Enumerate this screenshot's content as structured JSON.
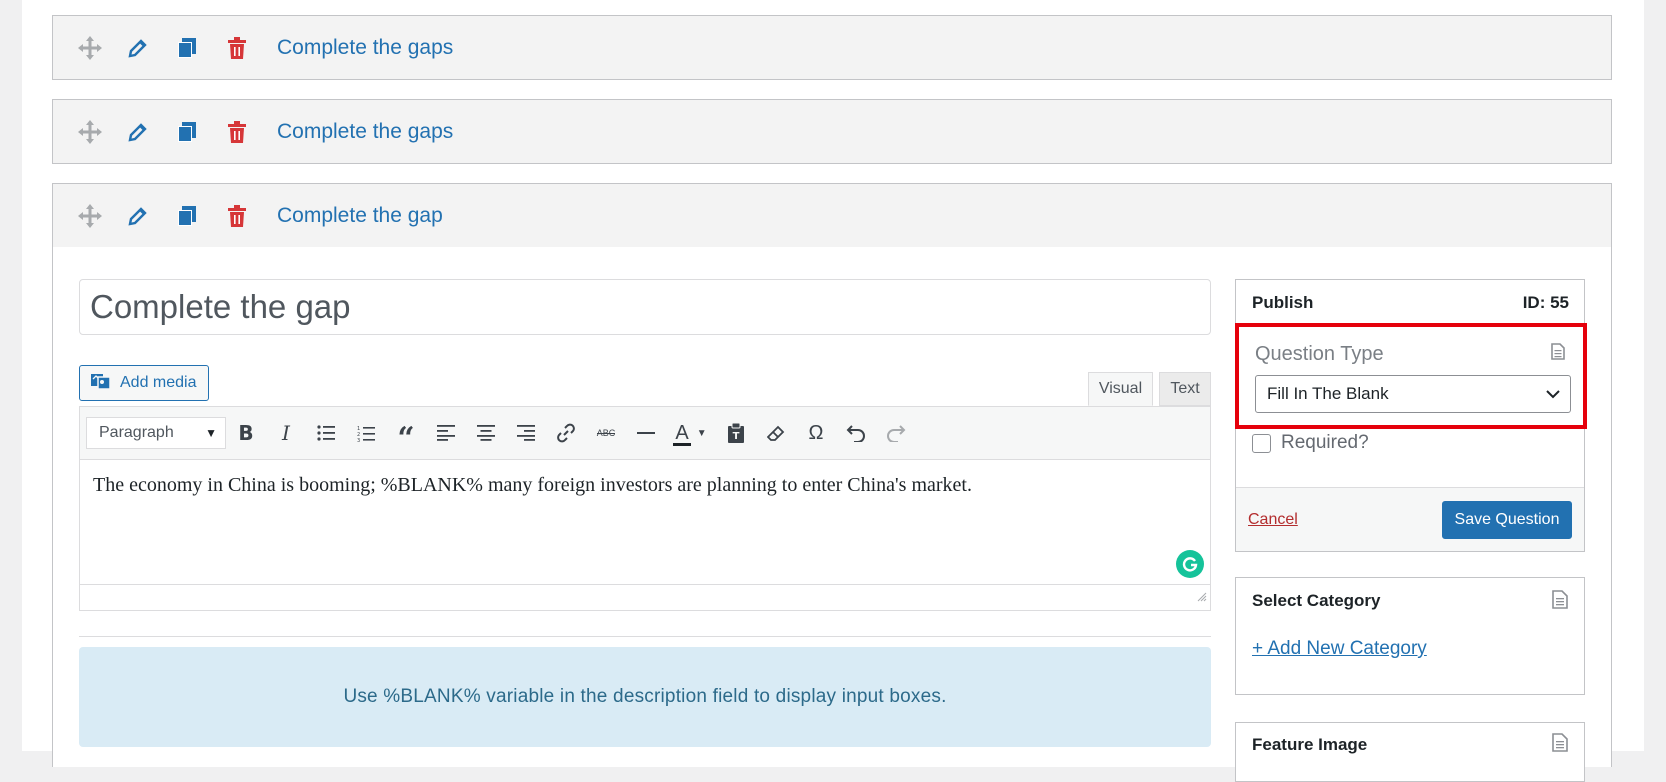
{
  "questions": [
    {
      "title": "Complete the gaps"
    },
    {
      "title": "Complete the gaps"
    },
    {
      "title": "Complete the gap"
    }
  ],
  "row_icons": {
    "move": "move-arrows-icon",
    "edit": "pencil-icon",
    "duplicate": "duplicate-icon",
    "delete": "trash-icon"
  },
  "editor": {
    "title_value": "Complete the gap",
    "add_media_label": "Add media",
    "tab_visual": "Visual",
    "tab_text": "Text",
    "format_select": "Paragraph",
    "body_text": "The economy in China is booming; %BLANK% many foreign investors are planning to enter China's market."
  },
  "notice": {
    "text": "Use %BLANK% variable in the description field to display input boxes."
  },
  "publish": {
    "title": "Publish",
    "id_label": "ID: 55",
    "question_type_label": "Question Type",
    "question_type_value": "Fill In The Blank",
    "required_label": "Required?",
    "cancel_label": "Cancel",
    "save_label": "Save Question"
  },
  "category": {
    "title": "Select Category",
    "add_new_label": "+ Add New Category"
  },
  "feature_image": {
    "title": "Feature Image"
  },
  "colors": {
    "accent": "#2271b1",
    "delete": "#d63638",
    "highlight": "#e5000b",
    "notice_bg": "#d9ebf5"
  }
}
